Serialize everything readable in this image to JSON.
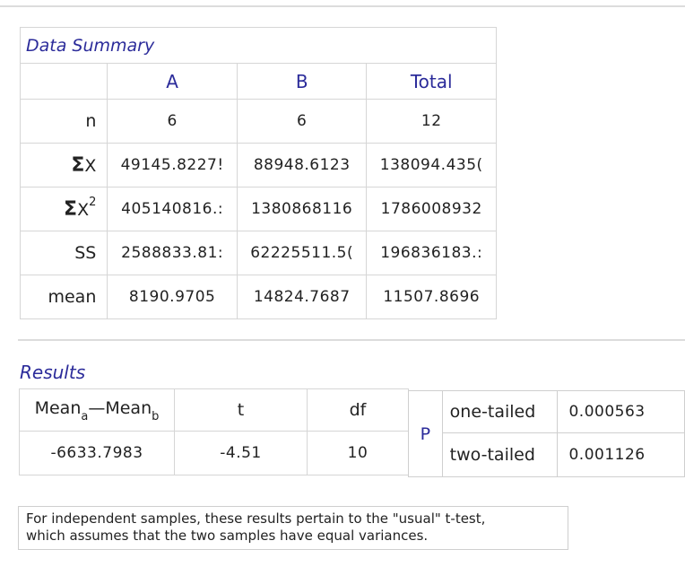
{
  "summary": {
    "title": "Data Summary",
    "columns": [
      "A",
      "B",
      "Total"
    ],
    "rows": [
      {
        "label": "n",
        "values": [
          "6",
          "6",
          "12"
        ]
      },
      {
        "label_sigma": "Σ",
        "label_var": "X",
        "values": [
          "49145.8227!",
          "88948.6123",
          "138094.435("
        ]
      },
      {
        "label_sigma": "Σ",
        "label_var": "X",
        "label_sup": "2",
        "values": [
          "405140816.:",
          "1380868116",
          "1786008932"
        ]
      },
      {
        "label": "SS",
        "values": [
          "2588833.81:",
          "62225511.5(",
          "196836183.:"
        ]
      },
      {
        "label": "mean",
        "values": [
          "8190.9705",
          "14824.7687",
          "11507.8696"
        ]
      }
    ]
  },
  "results": {
    "title": "Results",
    "headers": {
      "diff_main_a": "Mean",
      "diff_sub_a": "a",
      "diff_sep": "—",
      "diff_main_b": "Mean",
      "diff_sub_b": "b",
      "t": "t",
      "df": "df"
    },
    "values": {
      "diff": "-6633.7983",
      "t": "-4.51",
      "df": "10"
    },
    "p": {
      "label": "P",
      "one_tailed_label": "one-tailed",
      "one_tailed_value": "0.000563",
      "two_tailed_label": "two-tailed",
      "two_tailed_value": "0.001126"
    }
  },
  "note": {
    "line1": "For independent samples, these results pertain to the \"usual\" t-test,",
    "line2": "which assumes that the two samples have equal variances."
  }
}
